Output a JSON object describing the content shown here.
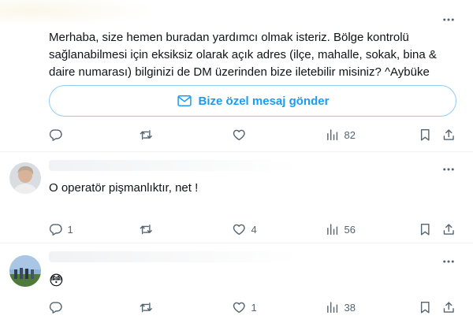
{
  "tweets": [
    {
      "text": "Merhaba, size hemen buradan yardımcı olmak isteriz. Bölge kontrolü sağlanabilmesi için eksiksiz olarak açık adres (ilçe, mahalle, sokak, bina & daire numarası) bilginizi de DM üzerinden bize iletebilir misiniz? ^Aybüke",
      "dm_button_label": "Bize özel mesaj gönder",
      "reply_count": "",
      "retweet_count": "",
      "like_count": "",
      "view_count": "82"
    },
    {
      "text": "O operatör pişmanlıktır, net !",
      "reply_count": "1",
      "retweet_count": "",
      "like_count": "4",
      "view_count": "56"
    },
    {
      "text": "😳",
      "reply_count": "",
      "retweet_count": "",
      "like_count": "1",
      "view_count": "38"
    }
  ],
  "colors": {
    "accent": "#1d9bf0",
    "muted": "#536471",
    "text": "#0f1419",
    "divider": "#eff3f4"
  },
  "icons": [
    "more-icon",
    "envelope-icon",
    "reply-icon",
    "retweet-icon",
    "like-icon",
    "views-icon",
    "bookmark-icon",
    "share-icon"
  ]
}
